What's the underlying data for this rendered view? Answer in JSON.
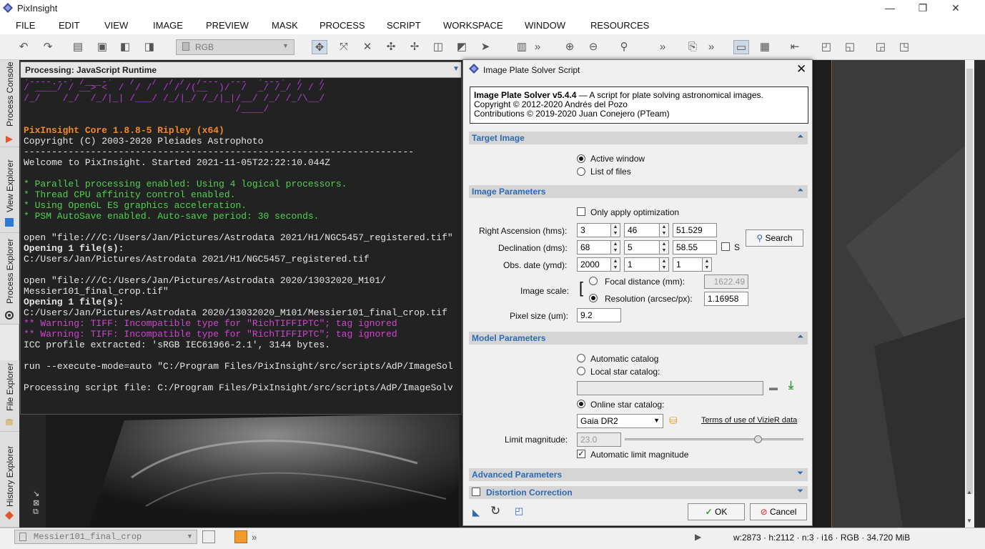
{
  "app": {
    "title": "PixInsight"
  },
  "menu": [
    "FILE",
    "EDIT",
    "VIEW",
    "IMAGE",
    "PREVIEW",
    "MASK",
    "PROCESS",
    "SCRIPT",
    "WORKSPACE",
    "WINDOW",
    "RESOURCES"
  ],
  "toolbar": {
    "color_space": "RGB",
    "overflow": "»"
  },
  "sidebar": {
    "tabs": [
      "Process Console",
      "View Explorer",
      "Process Explorer",
      "File Explorer",
      "History Explorer"
    ]
  },
  "console": {
    "title": "Processing: JavaScript Runtime",
    "banner": [
      "'----.--' /___-'   /   /  / /  /---  ---  '---'  /   /",
      "/ ____/ / __> <  /  / /  / / /(__  )/  /  _/ /_/ / / /",
      "/_/    /_/  /_/|_| /___/ /_/|_/ /_/|_|/__/ /_/ /_/\\__/",
      "                                      /____/"
    ],
    "core": "PixInsight Core 1.8.8-5 Ripley (x64)",
    "copyright": "Copyright (C) 2003-2020 Pleiades Astrophoto",
    "rule": "----------------------------------------------------------------------",
    "welcome": "Welcome to PixInsight. Started 2021-11-05T22:22:10.044Z",
    "features": [
      "* Parallel processing enabled: Using 4 logical processors.",
      "* Thread CPU affinity control enabled.",
      "* Using OpenGL ES graphics acceleration.",
      "* PSM AutoSave enabled. Auto-save period: 30 seconds."
    ],
    "open1": "open \"file:///C:/Users/Jan/Pictures/Astrodata 2021/H1/NGC5457_registered.tif\"",
    "opening1": "Opening 1 file(s):",
    "path1": "C:/Users/Jan/Pictures/Astrodata 2021/H1/NGC5457_registered.tif",
    "open2a": "open \"file:///C:/Users/Jan/Pictures/Astrodata 2020/13032020_M101/",
    "open2b": "Messier101_final_crop.tif\"",
    "opening2": "Opening 1 file(s):",
    "path2": "C:/Users/Jan/Pictures/Astrodata 2020/13032020_M101/Messier101_final_crop.tif",
    "warn1": "** Warning: TIFF: Incompatible type for \"RichTIFFIPTC\"; tag ignored",
    "warn2": "** Warning: TIFF: Incompatible type for \"RichTIFFIPTC\"; tag ignored",
    "icc": "ICC profile extracted: 'sRGB IEC61966-2.1', 3144 bytes.",
    "run": "run --execute-mode=auto \"C:/Program Files/PixInsight/src/scripts/AdP/ImageSol",
    "processing": "Processing script file: C:/Program Files/PixInsight/src/scripts/AdP/ImageSolv"
  },
  "dialog": {
    "title": "Image Plate Solver Script",
    "info_title": "Image Plate Solver v5.4.4",
    "info_tail": " — A script for plate solving astronomical images.",
    "info_line2": "Copyright © 2012-2020 Andrés del Pozo",
    "info_line3": "Contributions © 2019-2020 Juan Conejero (PTeam)",
    "sections": {
      "target": "Target Image",
      "image": "Image Parameters",
      "model": "Model Parameters",
      "advanced": "Advanced Parameters",
      "distortion": "Distortion Correction"
    },
    "target": {
      "active_window": "Active window",
      "list_of_files": "List of files"
    },
    "image": {
      "only_opt": "Only apply optimization",
      "ra_label": "Right Ascension (hms):",
      "ra": [
        "3",
        "46",
        "51.529"
      ],
      "dec_label": "Declination (dms):",
      "dec": [
        "68",
        "5",
        "58.55"
      ],
      "south": "S",
      "date_label": "Obs. date (ymd):",
      "date": [
        "2000",
        "1",
        "1"
      ],
      "search": "Search",
      "scale_label": "Image scale:",
      "focal_label": "Focal distance (mm):",
      "focal": "1622.49",
      "res_label": "Resolution (arcsec/px):",
      "res": "1.16958",
      "pixel_label": "Pixel size (um):",
      "pixel": "9.2"
    },
    "model": {
      "auto_catalog": "Automatic catalog",
      "local_catalog": "Local star catalog:",
      "local_path": "",
      "online_catalog": "Online star catalog:",
      "catalog": "Gaia DR2",
      "vizier_link": "Terms of use of VizieR data",
      "limit_label": "Limit magnitude:",
      "limit": "23.0",
      "limit_fraction": 0.76,
      "auto_limit": "Automatic limit magnitude"
    },
    "ok": "OK",
    "cancel": "Cancel"
  },
  "status": {
    "view": "Messier101_final_crop",
    "info": "w:2873 · h:2112 · n:3 · i16 · RGB · 34.720 MiB"
  }
}
